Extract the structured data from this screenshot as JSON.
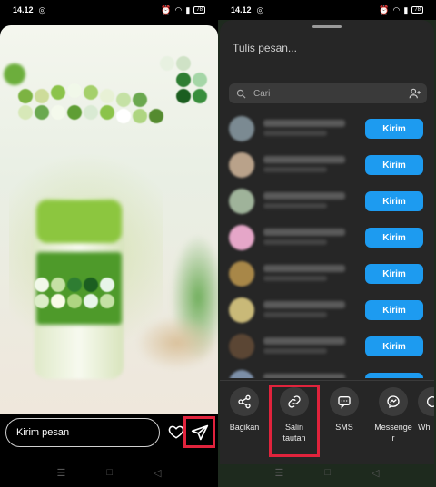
{
  "left": {
    "status": {
      "time": "14.12",
      "battery": "78"
    },
    "message_placeholder": "Kirim pesan",
    "nav": {
      "menu": "☰",
      "home": "□",
      "back": "◁"
    }
  },
  "right": {
    "status": {
      "time": "14.12",
      "battery": "78"
    },
    "compose_placeholder": "Tulis pesan...",
    "search_placeholder": "Cari",
    "send_label": "Kirim",
    "contacts": [
      {
        "avatar_color": "#7b8a92"
      },
      {
        "avatar_color": "#b9a28a"
      },
      {
        "avatar_color": "#9fb39a"
      },
      {
        "avatar_color": "#e5a6c8"
      },
      {
        "avatar_color": "#a88748"
      },
      {
        "avatar_color": "#c9b978"
      },
      {
        "avatar_color": "#5b4634"
      },
      {
        "avatar_color": "#7c8fa8"
      }
    ],
    "actions": [
      {
        "label": "Bagikan",
        "icon": "share-icon"
      },
      {
        "label": "Salin tautan",
        "icon": "link-icon"
      },
      {
        "label": "SMS",
        "icon": "sms-icon"
      },
      {
        "label": "Messenger",
        "icon": "messenger-icon"
      },
      {
        "label": "Wh",
        "icon": "whatsapp-icon"
      }
    ],
    "nav": {
      "menu": "☰",
      "home": "□",
      "back": "◁"
    }
  },
  "colors": {
    "highlight": "#e0233c",
    "send_button": "#1d9bf0",
    "sheet": "#262626"
  }
}
